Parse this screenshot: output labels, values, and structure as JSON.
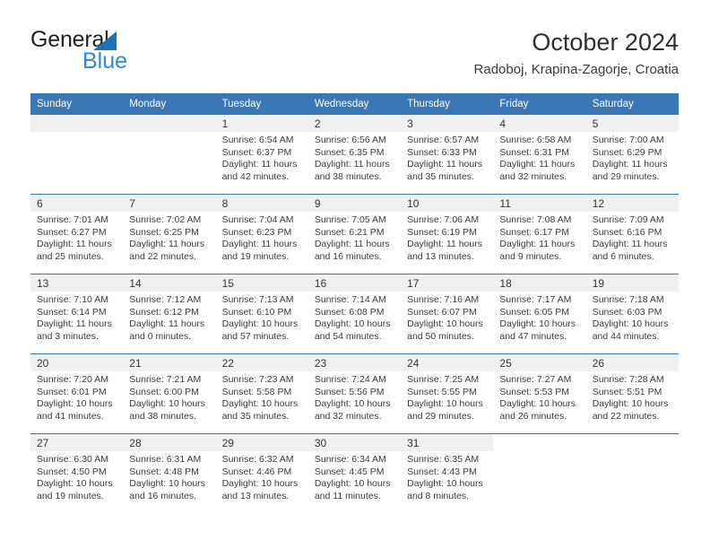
{
  "brand": {
    "name_part1": "General",
    "name_part2": "Blue",
    "accent_color": "#2b8ad6",
    "triangle_color": "#1c71b9"
  },
  "header": {
    "title": "October 2024",
    "subtitle": "Radoboj, Krapina-Zagorje, Croatia"
  },
  "calendar": {
    "header_bg": "#3a77b5",
    "daynum_band_bg": "#f0f0f0",
    "weekday_headers": [
      "Sunday",
      "Monday",
      "Tuesday",
      "Wednesday",
      "Thursday",
      "Friday",
      "Saturday"
    ],
    "weeks": [
      [
        {
          "day": "",
          "sunrise": "",
          "sunset": "",
          "daylight": ""
        },
        {
          "day": "",
          "sunrise": "",
          "sunset": "",
          "daylight": ""
        },
        {
          "day": "1",
          "sunrise": "Sunrise: 6:54 AM",
          "sunset": "Sunset: 6:37 PM",
          "daylight": "Daylight: 11 hours and 42 minutes."
        },
        {
          "day": "2",
          "sunrise": "Sunrise: 6:56 AM",
          "sunset": "Sunset: 6:35 PM",
          "daylight": "Daylight: 11 hours and 38 minutes."
        },
        {
          "day": "3",
          "sunrise": "Sunrise: 6:57 AM",
          "sunset": "Sunset: 6:33 PM",
          "daylight": "Daylight: 11 hours and 35 minutes."
        },
        {
          "day": "4",
          "sunrise": "Sunrise: 6:58 AM",
          "sunset": "Sunset: 6:31 PM",
          "daylight": "Daylight: 11 hours and 32 minutes."
        },
        {
          "day": "5",
          "sunrise": "Sunrise: 7:00 AM",
          "sunset": "Sunset: 6:29 PM",
          "daylight": "Daylight: 11 hours and 29 minutes."
        }
      ],
      [
        {
          "day": "6",
          "sunrise": "Sunrise: 7:01 AM",
          "sunset": "Sunset: 6:27 PM",
          "daylight": "Daylight: 11 hours and 25 minutes."
        },
        {
          "day": "7",
          "sunrise": "Sunrise: 7:02 AM",
          "sunset": "Sunset: 6:25 PM",
          "daylight": "Daylight: 11 hours and 22 minutes."
        },
        {
          "day": "8",
          "sunrise": "Sunrise: 7:04 AM",
          "sunset": "Sunset: 6:23 PM",
          "daylight": "Daylight: 11 hours and 19 minutes."
        },
        {
          "day": "9",
          "sunrise": "Sunrise: 7:05 AM",
          "sunset": "Sunset: 6:21 PM",
          "daylight": "Daylight: 11 hours and 16 minutes."
        },
        {
          "day": "10",
          "sunrise": "Sunrise: 7:06 AM",
          "sunset": "Sunset: 6:19 PM",
          "daylight": "Daylight: 11 hours and 13 minutes."
        },
        {
          "day": "11",
          "sunrise": "Sunrise: 7:08 AM",
          "sunset": "Sunset: 6:17 PM",
          "daylight": "Daylight: 11 hours and 9 minutes."
        },
        {
          "day": "12",
          "sunrise": "Sunrise: 7:09 AM",
          "sunset": "Sunset: 6:16 PM",
          "daylight": "Daylight: 11 hours and 6 minutes."
        }
      ],
      [
        {
          "day": "13",
          "sunrise": "Sunrise: 7:10 AM",
          "sunset": "Sunset: 6:14 PM",
          "daylight": "Daylight: 11 hours and 3 minutes."
        },
        {
          "day": "14",
          "sunrise": "Sunrise: 7:12 AM",
          "sunset": "Sunset: 6:12 PM",
          "daylight": "Daylight: 11 hours and 0 minutes."
        },
        {
          "day": "15",
          "sunrise": "Sunrise: 7:13 AM",
          "sunset": "Sunset: 6:10 PM",
          "daylight": "Daylight: 10 hours and 57 minutes."
        },
        {
          "day": "16",
          "sunrise": "Sunrise: 7:14 AM",
          "sunset": "Sunset: 6:08 PM",
          "daylight": "Daylight: 10 hours and 54 minutes."
        },
        {
          "day": "17",
          "sunrise": "Sunrise: 7:16 AM",
          "sunset": "Sunset: 6:07 PM",
          "daylight": "Daylight: 10 hours and 50 minutes."
        },
        {
          "day": "18",
          "sunrise": "Sunrise: 7:17 AM",
          "sunset": "Sunset: 6:05 PM",
          "daylight": "Daylight: 10 hours and 47 minutes."
        },
        {
          "day": "19",
          "sunrise": "Sunrise: 7:18 AM",
          "sunset": "Sunset: 6:03 PM",
          "daylight": "Daylight: 10 hours and 44 minutes."
        }
      ],
      [
        {
          "day": "20",
          "sunrise": "Sunrise: 7:20 AM",
          "sunset": "Sunset: 6:01 PM",
          "daylight": "Daylight: 10 hours and 41 minutes."
        },
        {
          "day": "21",
          "sunrise": "Sunrise: 7:21 AM",
          "sunset": "Sunset: 6:00 PM",
          "daylight": "Daylight: 10 hours and 38 minutes."
        },
        {
          "day": "22",
          "sunrise": "Sunrise: 7:23 AM",
          "sunset": "Sunset: 5:58 PM",
          "daylight": "Daylight: 10 hours and 35 minutes."
        },
        {
          "day": "23",
          "sunrise": "Sunrise: 7:24 AM",
          "sunset": "Sunset: 5:56 PM",
          "daylight": "Daylight: 10 hours and 32 minutes."
        },
        {
          "day": "24",
          "sunrise": "Sunrise: 7:25 AM",
          "sunset": "Sunset: 5:55 PM",
          "daylight": "Daylight: 10 hours and 29 minutes."
        },
        {
          "day": "25",
          "sunrise": "Sunrise: 7:27 AM",
          "sunset": "Sunset: 5:53 PM",
          "daylight": "Daylight: 10 hours and 26 minutes."
        },
        {
          "day": "26",
          "sunrise": "Sunrise: 7:28 AM",
          "sunset": "Sunset: 5:51 PM",
          "daylight": "Daylight: 10 hours and 22 minutes."
        }
      ],
      [
        {
          "day": "27",
          "sunrise": "Sunrise: 6:30 AM",
          "sunset": "Sunset: 4:50 PM",
          "daylight": "Daylight: 10 hours and 19 minutes."
        },
        {
          "day": "28",
          "sunrise": "Sunrise: 6:31 AM",
          "sunset": "Sunset: 4:48 PM",
          "daylight": "Daylight: 10 hours and 16 minutes."
        },
        {
          "day": "29",
          "sunrise": "Sunrise: 6:32 AM",
          "sunset": "Sunset: 4:46 PM",
          "daylight": "Daylight: 10 hours and 13 minutes."
        },
        {
          "day": "30",
          "sunrise": "Sunrise: 6:34 AM",
          "sunset": "Sunset: 4:45 PM",
          "daylight": "Daylight: 10 hours and 11 minutes."
        },
        {
          "day": "31",
          "sunrise": "Sunrise: 6:35 AM",
          "sunset": "Sunset: 4:43 PM",
          "daylight": "Daylight: 10 hours and 8 minutes."
        },
        {
          "day": "",
          "sunrise": "",
          "sunset": "",
          "daylight": ""
        },
        {
          "day": "",
          "sunrise": "",
          "sunset": "",
          "daylight": ""
        }
      ]
    ]
  }
}
